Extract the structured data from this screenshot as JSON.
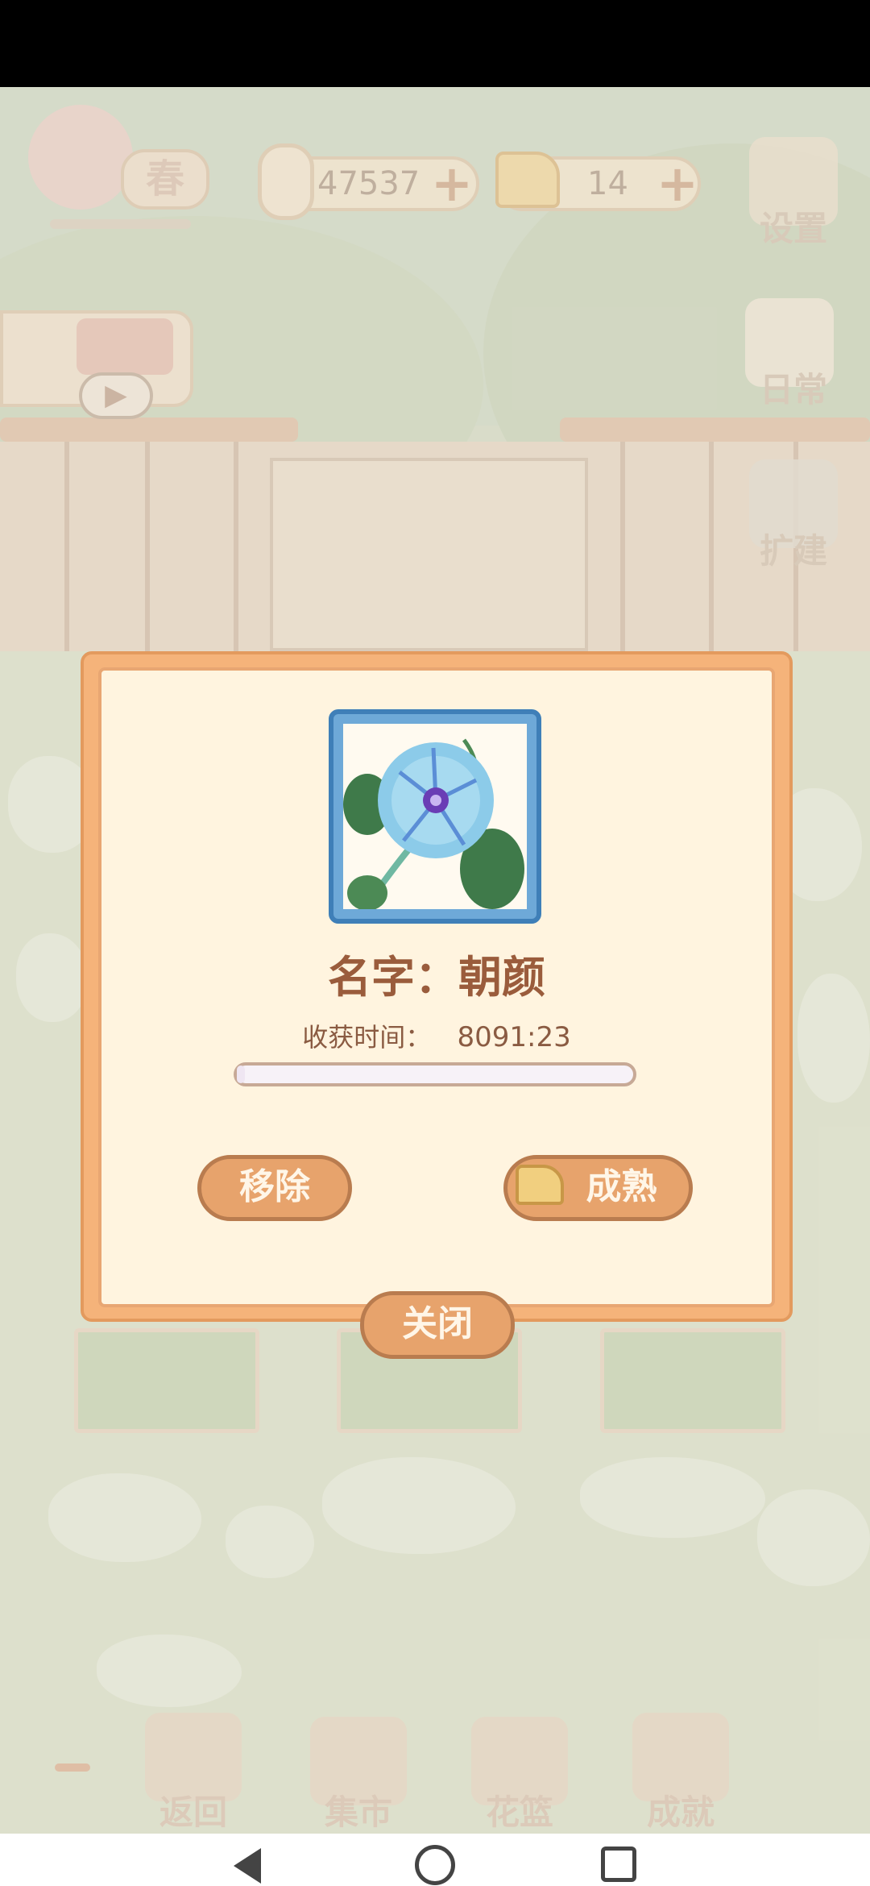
{
  "hud": {
    "season_label": "春",
    "fish_count": "47537",
    "cheese_count": "14",
    "settings_label": "设置",
    "daily_label": "日常",
    "expand_label": "扩建"
  },
  "dialog": {
    "name_line": "名字：朝颜",
    "harvest_label": "收获时间：",
    "harvest_time": "8091:23",
    "progress": 0.02,
    "remove_label": "移除",
    "mature_label": "成熟",
    "close_label": "关闭"
  },
  "bottom_nav": {
    "back_label": "返回",
    "market_label": "集市",
    "basket_label": "花篮",
    "achievement_label": "成就"
  },
  "colors": {
    "dialog_border": "#f5b37a",
    "dialog_bg": "#fff4df",
    "frame_blue": "#3f7fb8",
    "button_brown": "#e7a36c"
  }
}
